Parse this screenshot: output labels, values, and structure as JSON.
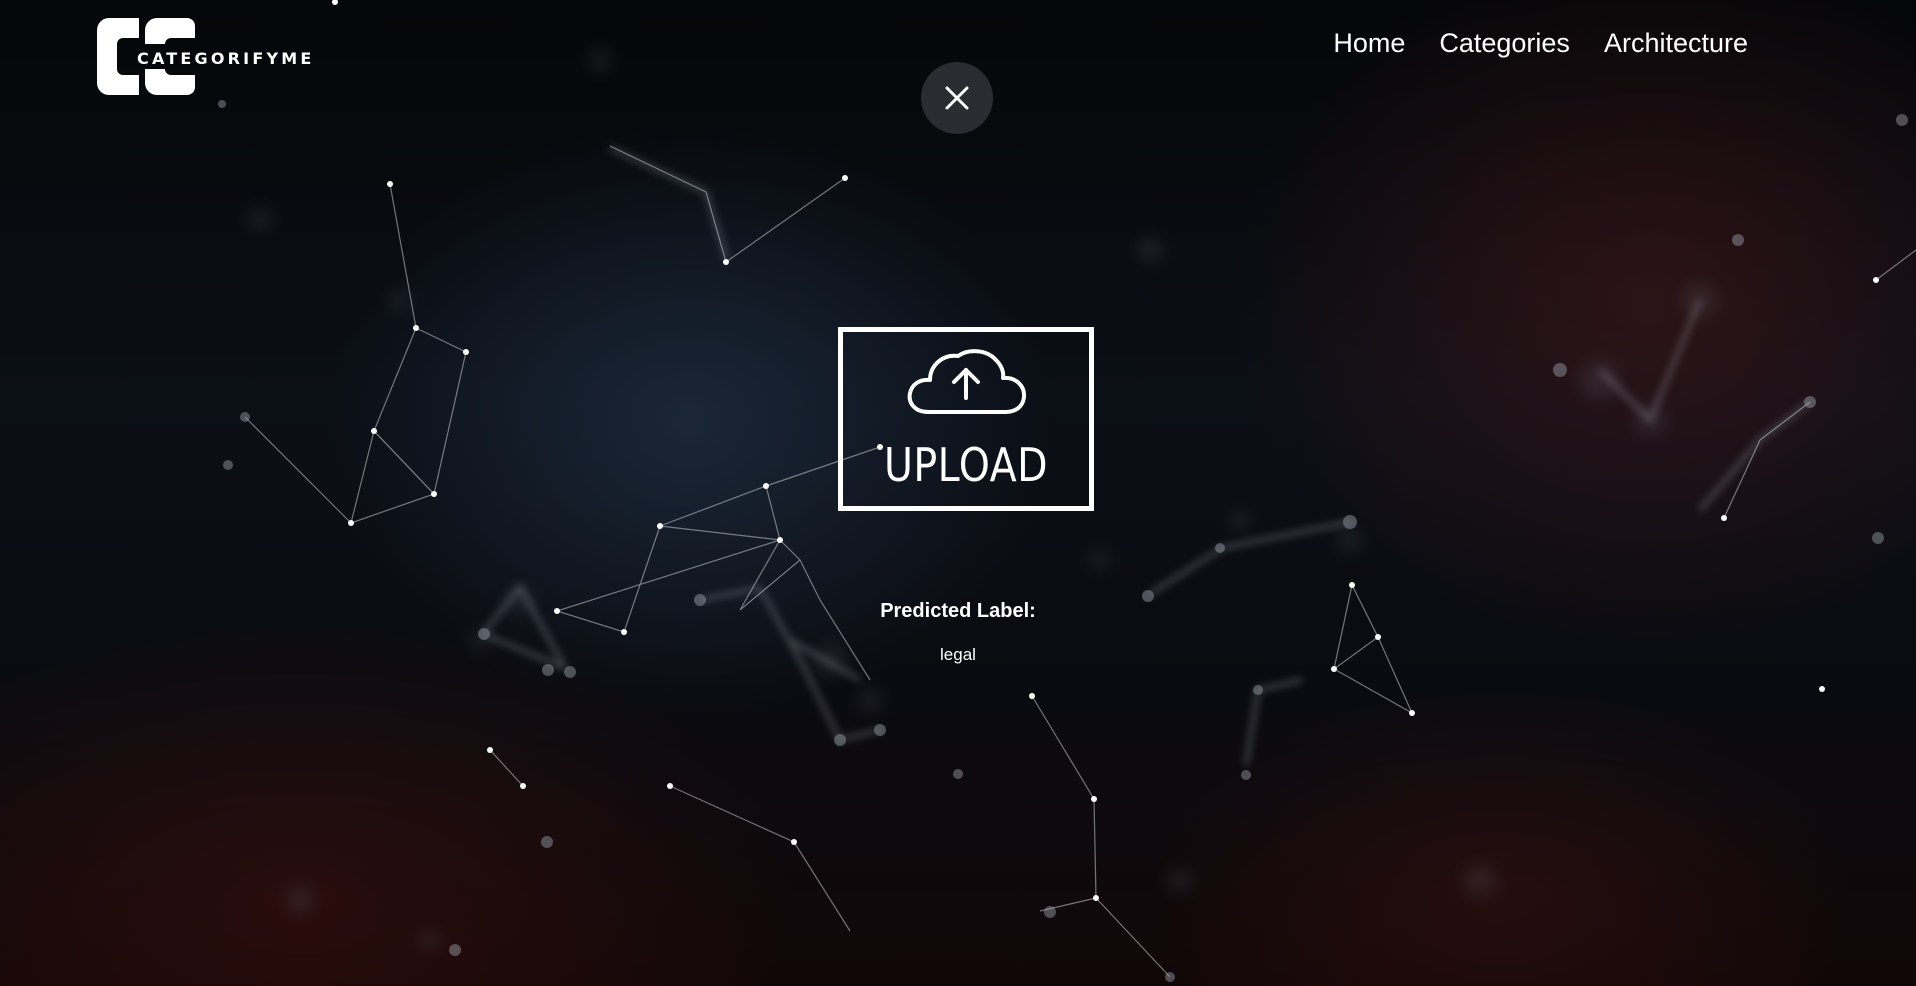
{
  "brand": {
    "name": "CATEGORIFYME",
    "logo_icon": "cc-logo-icon"
  },
  "nav": {
    "items": [
      {
        "label": "Home"
      },
      {
        "label": "Categories"
      },
      {
        "label": "Architecture"
      }
    ]
  },
  "close_button": {
    "icon": "close-icon"
  },
  "upload": {
    "label": "UPLOAD",
    "icon": "cloud-upload-icon"
  },
  "prediction": {
    "title": "Predicted Label:",
    "value": "legal"
  },
  "colors": {
    "text": "#ffffff",
    "close_bg": "#2b2c31",
    "background": "#05070b"
  }
}
